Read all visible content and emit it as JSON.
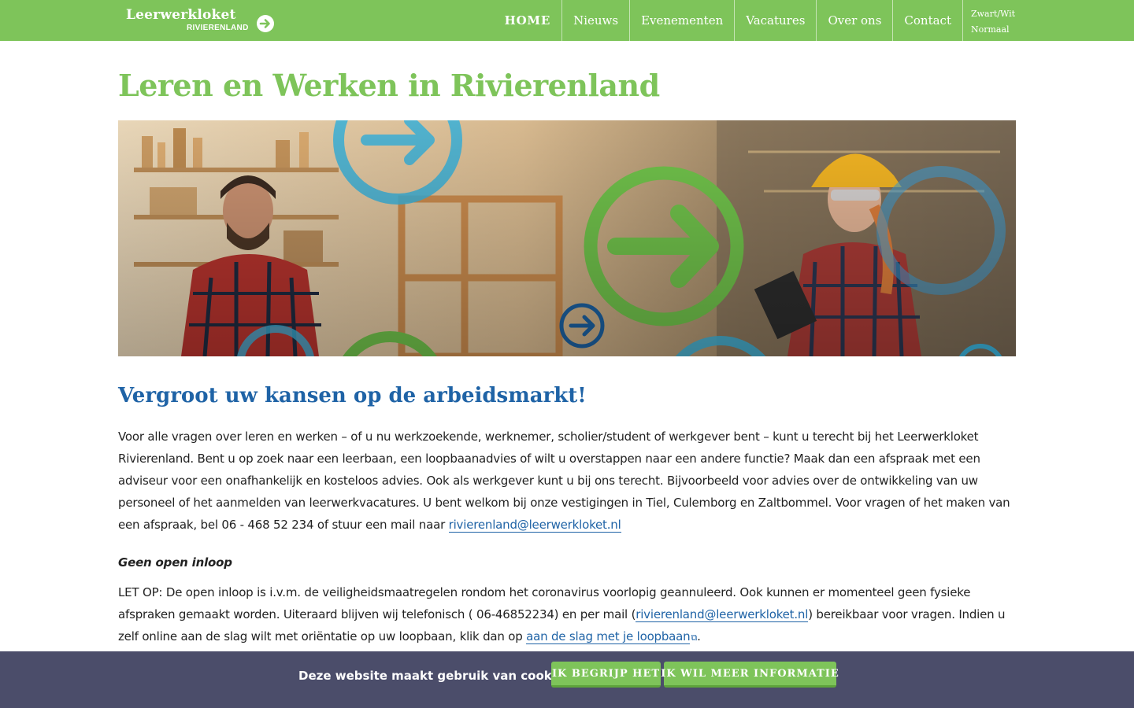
{
  "logo": {
    "main": "Leerwerkloket",
    "sub": "RIVIERENLAND",
    "arrow_icon": "arrow-right-circle-icon"
  },
  "nav": {
    "items": [
      {
        "label": "HOME",
        "active": true
      },
      {
        "label": "Nieuws"
      },
      {
        "label": "Evenementen"
      },
      {
        "label": "Vacatures"
      },
      {
        "label": "Over ons"
      },
      {
        "label": "Contact"
      }
    ],
    "contrast": {
      "option1": "Zwart/Wit",
      "option2": "Normaal"
    }
  },
  "page": {
    "title": "Leren en Werken in Rivierenland",
    "subheading": "Vergroot uw kansen op de arbeidsmarkt!"
  },
  "intro": {
    "text": "Voor alle vragen over leren en werken – of u nu werkzoekende, werknemer, scholier/student of werkgever bent – kunt u terecht bij het Leerwerkloket Rivierenland. Bent u op zoek naar een leerbaan, een loopbaanadvies of wilt u overstappen naar een andere functie? Maak dan een afspraak met een adviseur voor een onafhankelijk en kosteloos advies. Ook als werkgever kunt u bij ons terecht. Bijvoorbeeld voor advies over de ontwikkeling van uw personeel of het aanmelden van leerwerkvacatures. U bent welkom bij onze vestigingen in Tiel, Culemborg en Zaltbommel. Voor vragen of het maken van een afspraak, bel 06 - 468 52 234 of stuur een mail naar ",
    "email": "rivierenland@leerwerkloket.nl"
  },
  "notice": {
    "heading": "Geen open inloop",
    "text1": "LET OP: De open inloop is i.v.m. de veiligheidsmaatregelen rondom het coronavirus voorlopig geannuleerd. Ook kunnen er momenteel geen fysieke afspraken gemaakt worden. Uiteraard blijven wij  telefonisch ( 06-46852234) en per mail  (",
    "email": "rivierenland@leerwerkloket.nl",
    "text2": ")  bereikbaar voor vragen. Indien u zelf online aan de slag wilt met oriëntatie op uw loopbaan, klik dan op ",
    "link": "aan de slag met je loopbaan",
    "text3": "."
  },
  "cookie": {
    "message": "Deze website maakt gebruik van cookies",
    "accept": "IK BEGRIJP HET",
    "more": "IK WIL MEER INFORMATIE"
  },
  "colors": {
    "brand_green": "#7ec45a",
    "title_blue": "#1f63a6",
    "cookie_bg": "#4b4d6a"
  }
}
